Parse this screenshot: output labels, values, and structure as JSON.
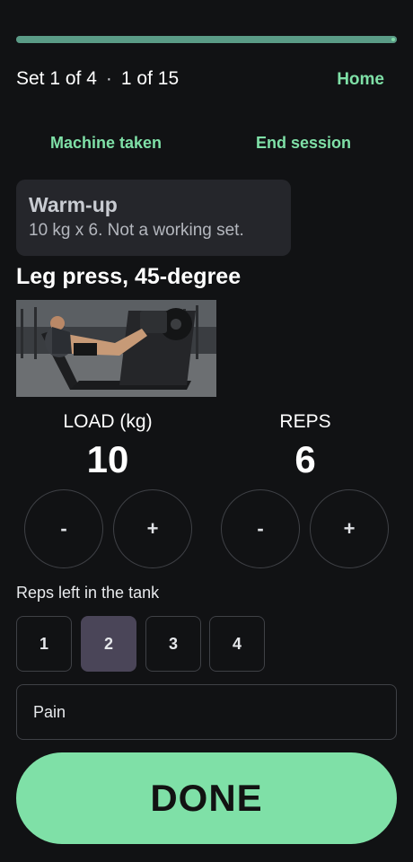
{
  "progress": {
    "fraction": 1.0
  },
  "status": {
    "set": "Set 1 of 4",
    "separator": "·",
    "exercise_index": "1 of 15"
  },
  "nav": {
    "home": "Home"
  },
  "actions": {
    "machine_taken": "Machine taken",
    "end_session": "End session"
  },
  "warmup": {
    "title": "Warm-up",
    "text": "10 kg x 6. Not a working set."
  },
  "exercise": {
    "title": "Leg press, 45-degree"
  },
  "load": {
    "label": "LOAD (kg)",
    "value": "10",
    "minus": "-",
    "plus": "+"
  },
  "reps": {
    "label": "REPS",
    "value": "6",
    "minus": "-",
    "plus": "+"
  },
  "rir": {
    "label": "Reps left in the tank",
    "options": [
      "1",
      "2",
      "3",
      "4"
    ],
    "selected": "2"
  },
  "pain": {
    "label": "Pain"
  },
  "done": {
    "label": "DONE"
  },
  "colors": {
    "accent": "#7fe0a7",
    "background": "#111214",
    "selected": "#4a4558"
  }
}
